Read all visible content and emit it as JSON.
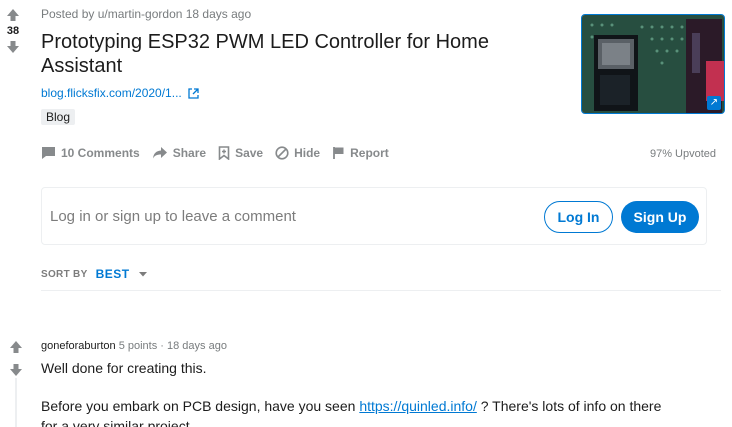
{
  "post": {
    "score": "38",
    "meta": "Posted by u/martin-gordon 18 days ago",
    "title": "Prototyping ESP32 PWM LED Controller for Home Assistant",
    "link": "blog.flicksfix.com/2020/1...",
    "flair": "Blog",
    "upvoted": "97% Upvoted"
  },
  "actions": {
    "comments": "10 Comments",
    "share": "Share",
    "save": "Save",
    "hide": "Hide",
    "report": "Report"
  },
  "comment_box": {
    "prompt": "Log in or sign up to leave a comment",
    "login": "Log In",
    "signup": "Sign Up"
  },
  "sort": {
    "label": "SORT BY",
    "value": "BEST"
  },
  "comment": {
    "author": "goneforaburton",
    "points": "5 points",
    "sep": "·",
    "age": "18 days ago",
    "line1": "Well done for creating this.",
    "line2_before": "Before you embark on PCB design, have you seen",
    "line2_link": "https://quinled.info/",
    "line2_after": "? There's lots of info on there for a very similar project."
  },
  "colors": {
    "accent": "#0079d3",
    "muted": "#878a8c",
    "text": "#1c1c1c"
  }
}
